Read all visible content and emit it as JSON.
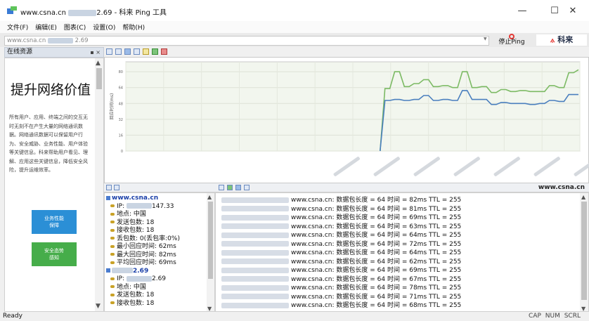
{
  "window": {
    "title_prefix": "www.csna.cn",
    "title_suffix": "2.69 - 科来 Ping 工具",
    "minimize": "—",
    "maximize": "☐",
    "close": "✕"
  },
  "menu": [
    "文件(F)",
    "编辑(E)",
    "图表(C)",
    "设置(O)",
    "帮助(H)"
  ],
  "address": {
    "value_prefix": "www.csna.cn",
    "value_suffix": "2.69",
    "stop_label": "停止Ping",
    "brand": "科来"
  },
  "left_panel": {
    "title": "在线资源",
    "close": "▪ ×",
    "ad_title": "提升网络价值",
    "ad_body": "所有用户、应用、终端之间的交互无时无刻不在产生大量的网络通讯数据。网络通讯数据可以保留用户行为、安全威胁、业务性能、用户体验等关键信息。科来帮助用户看见、理解、应用这些关键信息，降低安全风险，提升运维效率。",
    "btn1": "业务性能\n保障",
    "btn2": "安全态势\n感知"
  },
  "chart_data": {
    "type": "line",
    "ylabel": "回应时间(ms)",
    "yticks": [
      80,
      64,
      48,
      32,
      16,
      0
    ],
    "ylim": [
      0,
      90
    ],
    "grid": true,
    "series": [
      {
        "color": "#7cba64",
        "values": [
          null,
          null,
          null,
          null,
          null,
          null,
          null,
          null,
          null,
          null,
          null,
          null,
          null,
          null,
          null,
          null,
          null,
          null,
          null,
          null,
          null,
          null,
          null,
          null,
          null,
          null,
          null,
          null,
          null,
          null,
          null,
          null,
          null,
          null,
          null,
          null,
          null,
          null,
          null,
          null,
          null,
          null,
          null,
          null,
          null,
          null,
          null,
          null,
          null,
          null,
          null,
          null,
          0,
          63,
          63,
          80,
          80,
          65,
          65,
          68,
          68,
          72,
          72,
          65,
          65,
          66,
          66,
          64,
          64,
          80,
          80,
          64,
          64,
          65,
          65,
          59,
          59,
          62,
          62,
          60,
          60,
          61,
          61,
          60,
          60,
          60,
          60,
          66,
          66,
          64,
          64,
          79,
          79,
          82
        ]
      },
      {
        "color": "#4a7fbe",
        "values": [
          null,
          null,
          null,
          null,
          null,
          null,
          null,
          null,
          null,
          null,
          null,
          null,
          null,
          null,
          null,
          null,
          null,
          null,
          null,
          null,
          null,
          null,
          null,
          null,
          null,
          null,
          null,
          null,
          null,
          null,
          null,
          null,
          null,
          null,
          null,
          null,
          null,
          null,
          null,
          null,
          null,
          null,
          null,
          null,
          null,
          null,
          null,
          null,
          null,
          null,
          null,
          null,
          0,
          51,
          51,
          52,
          52,
          51,
          51,
          52,
          52,
          56,
          56,
          51,
          51,
          52,
          52,
          51,
          51,
          61,
          61,
          52,
          52,
          52,
          52,
          47,
          47,
          49,
          49,
          48,
          48,
          48,
          48,
          47,
          47,
          48,
          48,
          51,
          51,
          50,
          50,
          57,
          57,
          57
        ]
      }
    ]
  },
  "lower": {
    "target": "www.csna.cn"
  },
  "tree": [
    {
      "kind": "host",
      "text": "www.csna.cn"
    },
    {
      "kind": "item",
      "text": "IP: ",
      "tail": "147.33"
    },
    {
      "kind": "item",
      "text": "地点: 中国"
    },
    {
      "kind": "item",
      "text": "发送包数: 18"
    },
    {
      "kind": "item",
      "text": "接收包数: 18"
    },
    {
      "kind": "item",
      "text": "丢包数: 0(丢包率:0%)"
    },
    {
      "kind": "item",
      "text": "最小回应时间: 62ms"
    },
    {
      "kind": "item",
      "text": "最大回应时间: 82ms"
    },
    {
      "kind": "item",
      "text": "平均回应时间: 69ms"
    },
    {
      "kind": "host",
      "text": "2.69"
    },
    {
      "kind": "item",
      "text": "IP: ",
      "tail": "2.69"
    },
    {
      "kind": "item",
      "text": "地点: 中国"
    },
    {
      "kind": "item",
      "text": "发送包数: 18"
    },
    {
      "kind": "item",
      "text": "接收包数: 18"
    }
  ],
  "log": [
    "www.csna.cn: 数据包长度 = 64 时间 = 82ms TTL = 255",
    "www.csna.cn: 数据包长度 = 64 时间 = 81ms TTL = 255",
    "www.csna.cn: 数据包长度 = 64 时间 = 69ms TTL = 255",
    "www.csna.cn: 数据包长度 = 64 时间 = 63ms TTL = 255",
    "www.csna.cn: 数据包长度 = 64 时间 = 64ms TTL = 255",
    "www.csna.cn: 数据包长度 = 64 时间 = 72ms TTL = 255",
    "www.csna.cn: 数据包长度 = 64 时间 = 64ms TTL = 255",
    "www.csna.cn: 数据包长度 = 64 时间 = 62ms TTL = 255",
    "www.csna.cn: 数据包长度 = 64 时间 = 69ms TTL = 255",
    "www.csna.cn: 数据包长度 = 64 时间 = 67ms TTL = 255",
    "www.csna.cn: 数据包长度 = 64 时间 = 78ms TTL = 255",
    "www.csna.cn: 数据包长度 = 64 时间 = 71ms TTL = 255",
    "www.csna.cn: 数据包长度 = 64 时间 = 68ms TTL = 255"
  ],
  "status": {
    "left": "Ready",
    "right": "CAP NUM SCRL"
  }
}
